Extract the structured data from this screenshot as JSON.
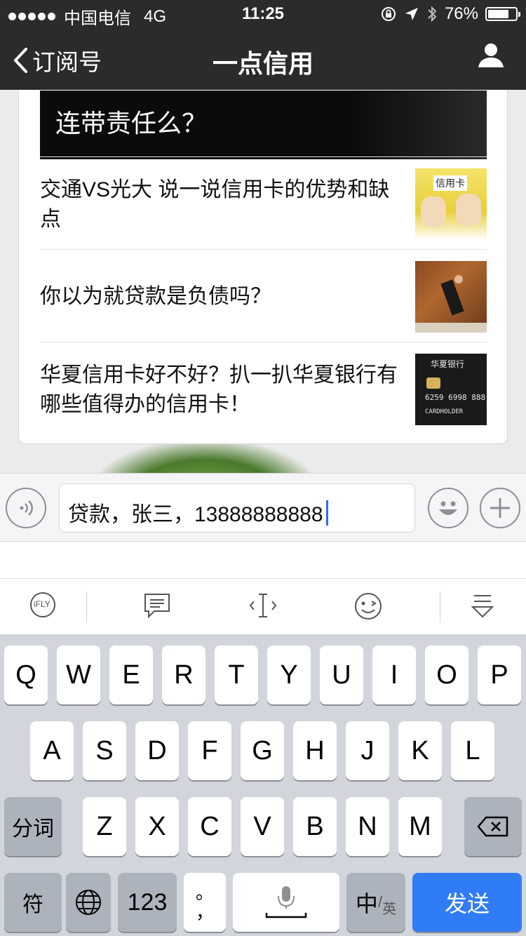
{
  "status_bar": {
    "carrier": "中国电信",
    "network": "4G",
    "time": "11:25",
    "battery": "76%",
    "battery_level": 0.76
  },
  "nav": {
    "back_label": "订阅号",
    "title": "一点信用"
  },
  "article": {
    "cover_title": "连带责任么？",
    "items": [
      {
        "title": "交通VS光大 说一说信用卡的优势和缺点",
        "thumb_text": "信用卡"
      },
      {
        "title": "你以为就贷款是负债吗？",
        "thumb_text": ""
      },
      {
        "title": "华夏信用卡好不好？扒一扒华夏银行有哪些值得办的信用卡！",
        "thumb_text": "华夏银行",
        "thumb_number": "6259 6998 888",
        "thumb_holder": "CARDHOLDER"
      }
    ]
  },
  "input": {
    "value": "贷款，张三，13888888888"
  },
  "keyboard_toolbar": {
    "ifly_label": "iFLY"
  },
  "keyboard": {
    "row1": [
      "Q",
      "W",
      "E",
      "R",
      "T",
      "Y",
      "U",
      "I",
      "O",
      "P"
    ],
    "row2": [
      "A",
      "S",
      "D",
      "F",
      "G",
      "H",
      "J",
      "K",
      "L"
    ],
    "row3": [
      "Z",
      "X",
      "C",
      "V",
      "B",
      "N",
      "M"
    ],
    "fenci": "分词",
    "fu": "符",
    "num": "123",
    "punct_top": "。",
    "punct_bottom": "，",
    "zh": "中",
    "en": "英",
    "send": "发送"
  }
}
